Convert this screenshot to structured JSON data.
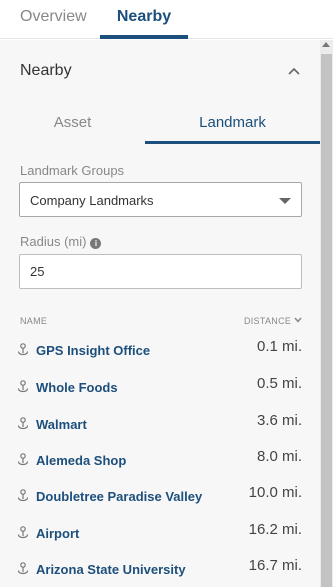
{
  "top_tabs": [
    {
      "label": "Overview"
    },
    {
      "label": "Nearby"
    }
  ],
  "section": {
    "title": "Nearby"
  },
  "sub_tabs": [
    {
      "label": "Asset"
    },
    {
      "label": "Landmark"
    }
  ],
  "landmark_groups": {
    "label": "Landmark Groups",
    "selected": "Company Landmarks"
  },
  "radius": {
    "label": "Radius (mi)",
    "value": "25"
  },
  "list": {
    "col_name": "NAME",
    "col_distance": "DISTANCE",
    "rows": [
      {
        "name": "GPS Insight Office",
        "distance": "0.1 mi."
      },
      {
        "name": "Whole Foods",
        "distance": "0.5 mi."
      },
      {
        "name": "Walmart",
        "distance": "3.6 mi."
      },
      {
        "name": "Alemeda Shop",
        "distance": "8.0 mi."
      },
      {
        "name": "Doubletree Paradise Valley",
        "distance": "10.0 mi."
      },
      {
        "name": "Airport",
        "distance": "16.2 mi."
      },
      {
        "name": "Arizona State University",
        "distance": "16.7 mi."
      }
    ]
  },
  "colors": {
    "accent": "#1d4f7c",
    "muted": "#888888",
    "panel_bg": "#f7f7f7"
  },
  "icons": {
    "collapse": "chevron-up-icon",
    "landmark": "landmark-pin-icon",
    "info": "info-icon",
    "sort": "chevron-down-icon",
    "dropdown": "caret-down-icon"
  }
}
